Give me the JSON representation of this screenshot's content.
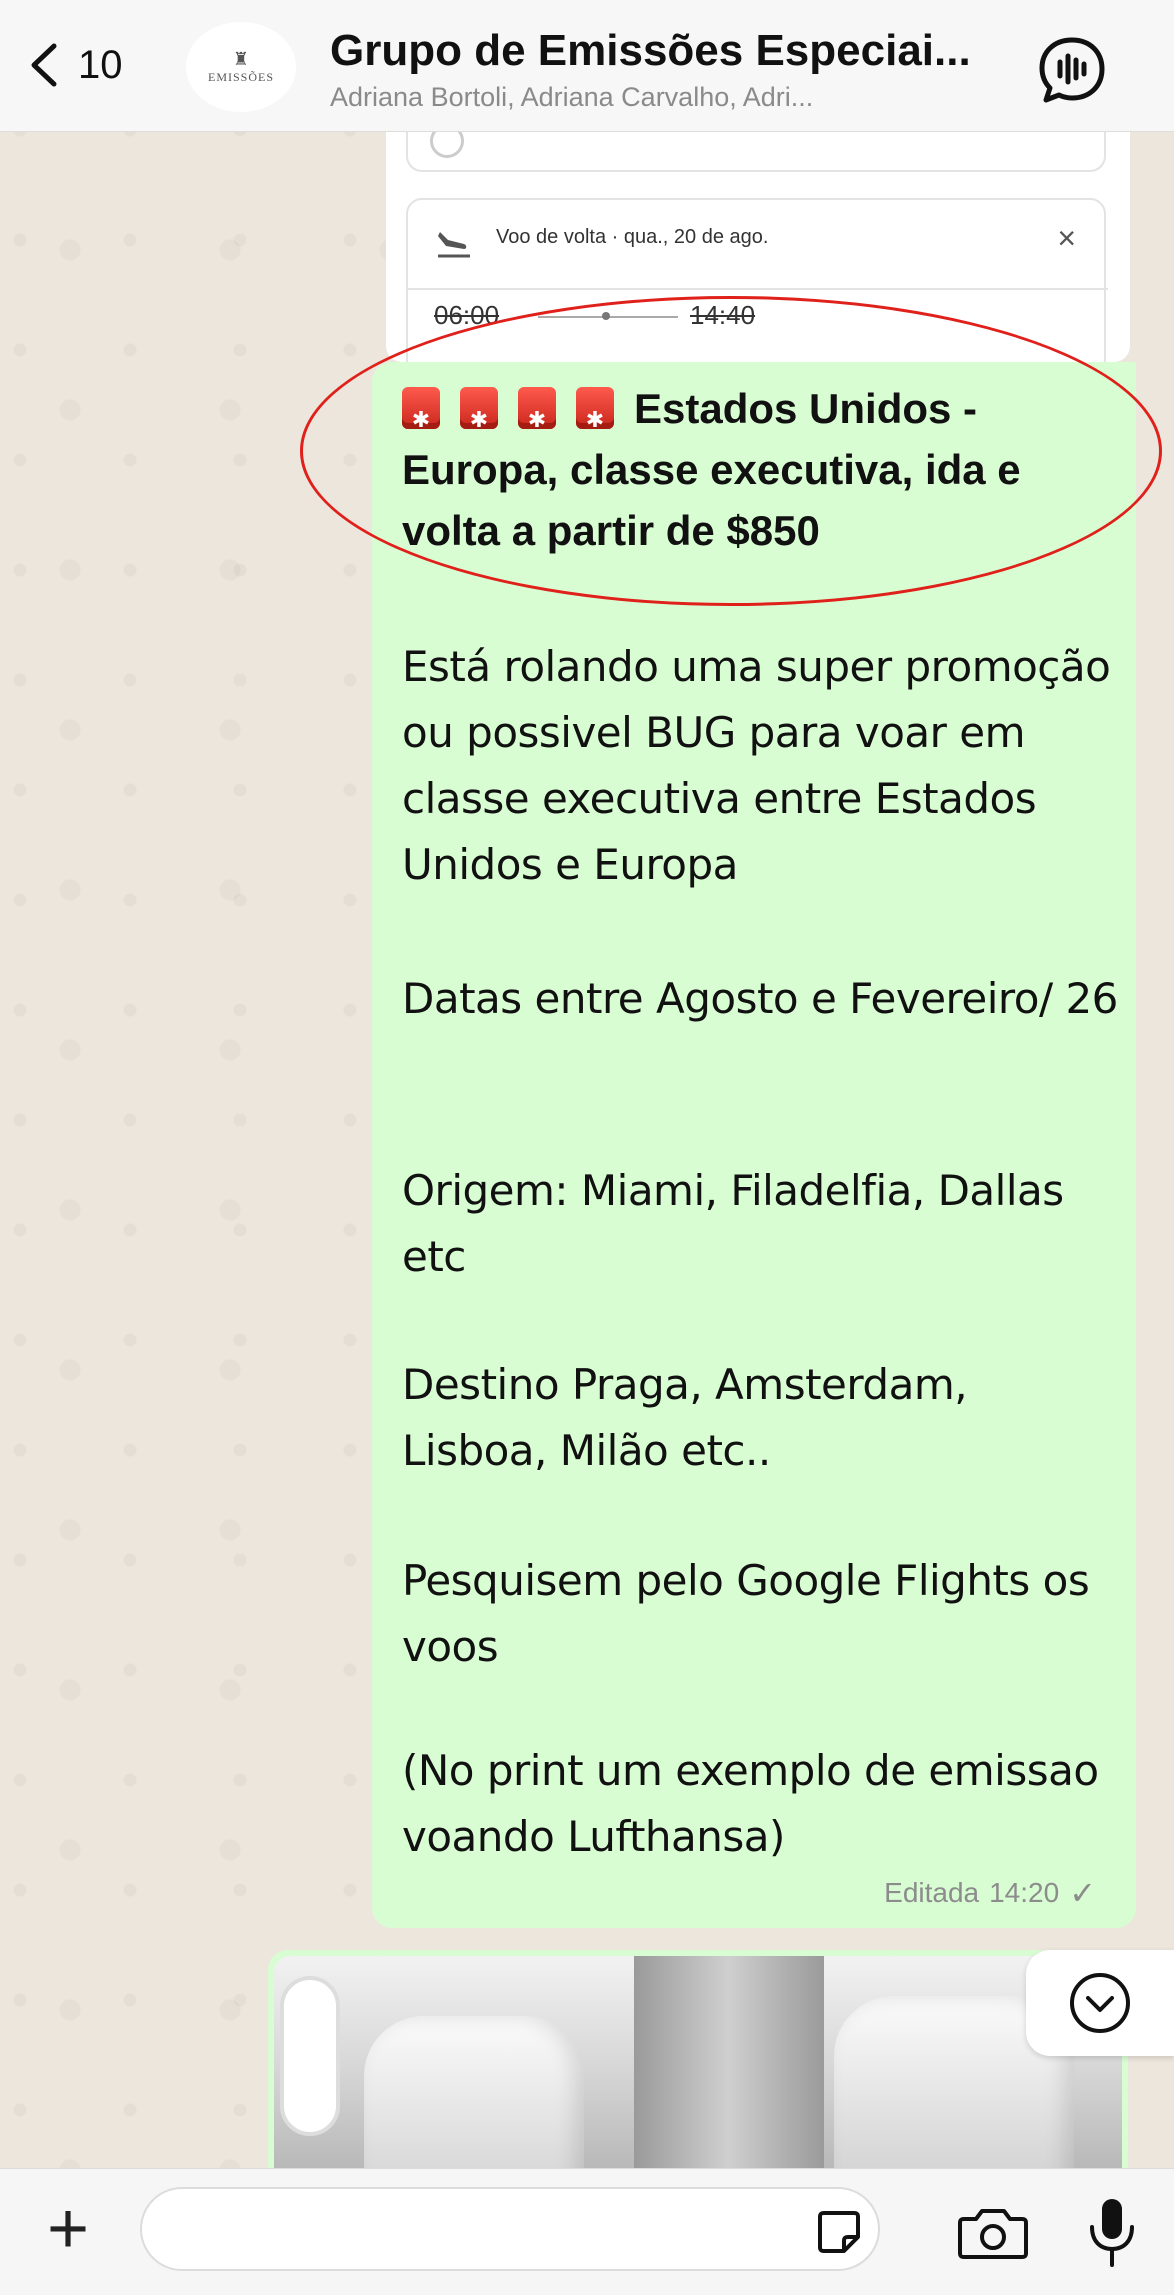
{
  "header": {
    "back_count": "10",
    "avatar_text": "EMISSÕES",
    "title": "Grupo de Emissões Especiai...",
    "subtitle": "Adriana Bortoli, Adriana Carvalho, Adri..."
  },
  "previous_message": {
    "return_flight_label": "Voo de volta · qua., 20 de ago.",
    "close_label": "×",
    "departure_time": "06:00",
    "arrival_time": "14:40"
  },
  "message": {
    "heading": "Estados Unidos - Europa, classe executiva, ida e volta a partir de $850",
    "paragraphs": [
      "Está rolando uma super promoção ou possivel BUG para voar em classe executiva entre Estados Unidos e Europa",
      "Datas entre Agosto e Fevereiro/ 26",
      "Origem: Miami, Filadelfia, Dallas etc",
      "Destino Praga, Amsterdam, Lisboa, Milão etc..",
      "Pesquisem pelo Google Flights os voos",
      "(No print um exemplo de emissao voando Lufthansa)"
    ],
    "edited_label": "Editada",
    "time": "14:20",
    "status_check": "✓",
    "alarm_icons": [
      "rotating-light-icon",
      "rotating-light-icon",
      "rotating-light-icon",
      "rotating-light-icon"
    ]
  },
  "composer": {
    "input_value": "",
    "input_placeholder": ""
  },
  "colors": {
    "bubble_outgoing": "#d9fdd3",
    "highlight_ellipse": "#e0201a",
    "header_bg": "#f7f7f7",
    "wallpaper": "#ece6dc"
  }
}
